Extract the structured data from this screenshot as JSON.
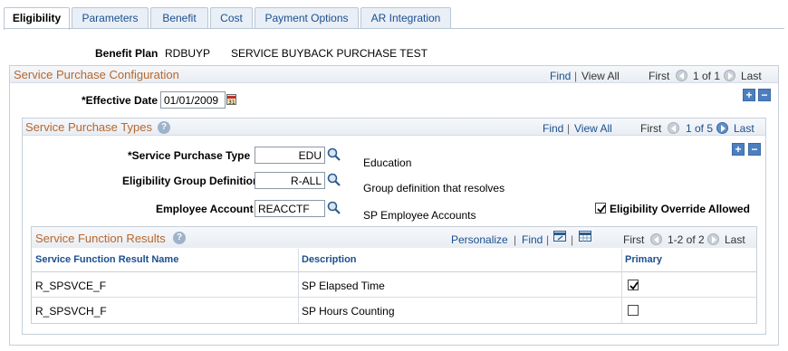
{
  "tabs": [
    "Eligibility",
    "Parameters",
    "Benefit",
    "Cost",
    "Payment Options",
    "AR Integration"
  ],
  "benefit_plan": {
    "label": "Benefit Plan",
    "code": "RDBUYP",
    "description": "SERVICE BUYBACK PURCHASE TEST"
  },
  "config": {
    "title": "Service Purchase Configuration",
    "find": "Find",
    "view_all": "View All",
    "first": "First",
    "range": "1 of 1",
    "last": "Last",
    "effective_date_label": "*Effective Date",
    "effective_date": "01/01/2009",
    "add": "+",
    "remove": "−"
  },
  "types": {
    "title": "Service Purchase Types",
    "find": "Find",
    "view_all": "View All",
    "first": "First",
    "range": "1 of 5",
    "last": "Last",
    "add": "+",
    "remove": "−",
    "type_label": "*Service Purchase Type",
    "type_value": "EDU",
    "type_desc": "Education",
    "group_label": "Eligibility Group Definition",
    "group_value": "R-ALL",
    "group_desc": "Group definition that resolves",
    "account_label": "Employee Account",
    "account_value": "REACCTF",
    "account_desc": "SP Employee Accounts",
    "override_label": "Eligibility Override Allowed",
    "override_checked": true
  },
  "results": {
    "title": "Service Function Results",
    "personalize": "Personalize",
    "find": "Find",
    "first": "First",
    "range": "1-2 of 2",
    "last": "Last",
    "columns": [
      "Service Function Result Name",
      "Description",
      "Primary"
    ],
    "rows": [
      {
        "name": "R_SPSVCE_F",
        "description": "SP Elapsed Time",
        "primary": true
      },
      {
        "name": "R_SPSVCH_F",
        "description": "SP Hours Counting",
        "primary": false
      }
    ]
  },
  "colors": {
    "link": "#1b4f8f",
    "section_title": "#b8672c",
    "border": "#c7cfd8"
  }
}
